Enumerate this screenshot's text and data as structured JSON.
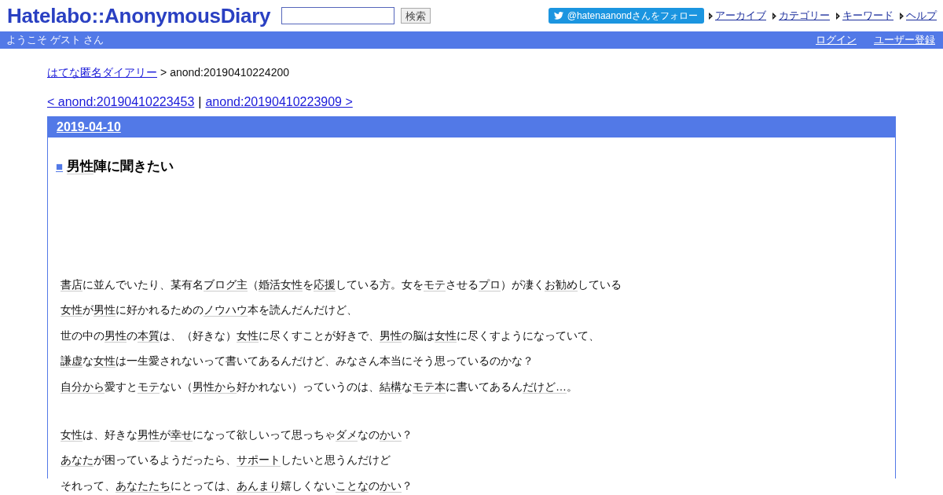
{
  "header": {
    "logo": "Hatelabo::AnonymousDiary",
    "search": {
      "button": "検索"
    },
    "follow_button": "@hatenaanondさんをフォロー",
    "nav_links": [
      "アーカイブ",
      "カテゴリー",
      "キーワード",
      "ヘルプ"
    ],
    "welcome": "ようこそ ゲスト さん",
    "user_links": [
      "ログイン",
      "ユーザー登録"
    ]
  },
  "breadcrumb": {
    "link": "はてな匿名ダイアリー",
    "separator": ">",
    "current": "anond:20190410224200"
  },
  "pager": {
    "prev": "< anond:20190410223453",
    "separator": "|",
    "next": "anond:20190410223909 >"
  },
  "entry": {
    "date": "2019-04-10",
    "title_mark": "■",
    "title": [
      {
        "text": "男性",
        "kind": "keyword"
      },
      {
        "text": "陣に聞きたい",
        "kind": "plain"
      }
    ],
    "paragraphs": [
      [
        [
          {
            "text": "書店",
            "kind": "keyword"
          },
          {
            "text": "に並んでいたり、某有名",
            "kind": "plain"
          },
          {
            "text": "ブログ主",
            "kind": "keyword"
          },
          {
            "text": "（",
            "kind": "plain"
          },
          {
            "text": "婚活",
            "kind": "keyword"
          },
          {
            "text": "女性",
            "kind": "keyword"
          },
          {
            "text": "を",
            "kind": "plain"
          },
          {
            "text": "応援",
            "kind": "keyword"
          },
          {
            "text": "している方。女を",
            "kind": "plain"
          },
          {
            "text": "モテ",
            "kind": "keyword"
          },
          {
            "text": "させる",
            "kind": "plain"
          },
          {
            "text": "プロ",
            "kind": "keyword"
          },
          {
            "text": "）が凄く",
            "kind": "plain"
          },
          {
            "text": "お勧め",
            "kind": "keyword"
          },
          {
            "text": "している",
            "kind": "plain"
          }
        ],
        [
          {
            "text": "女性",
            "kind": "keyword"
          },
          {
            "text": "が",
            "kind": "plain"
          },
          {
            "text": "男性",
            "kind": "keyword"
          },
          {
            "text": "に好かれるための",
            "kind": "plain"
          },
          {
            "text": "ノウハウ",
            "kind": "keyword"
          },
          {
            "text": "本を読んだんだけど、",
            "kind": "plain"
          }
        ],
        [
          {
            "text": "世の中の",
            "kind": "plain"
          },
          {
            "text": "男性",
            "kind": "keyword"
          },
          {
            "text": "の",
            "kind": "plain"
          },
          {
            "text": "本質",
            "kind": "keyword"
          },
          {
            "text": "は、（好きな）",
            "kind": "plain"
          },
          {
            "text": "女性",
            "kind": "keyword"
          },
          {
            "text": "に尽くすことが好きで、",
            "kind": "plain"
          },
          {
            "text": "男性",
            "kind": "keyword"
          },
          {
            "text": "の脳は",
            "kind": "plain"
          },
          {
            "text": "女性",
            "kind": "keyword"
          },
          {
            "text": "に尽くすようになっていて、",
            "kind": "plain"
          }
        ],
        [
          {
            "text": "謙虚",
            "kind": "keyword"
          },
          {
            "text": "な",
            "kind": "plain"
          },
          {
            "text": "女性",
            "kind": "keyword"
          },
          {
            "text": "は一生愛されないって書いてあるんだけど、みなさん本当にそう思っているのかな？",
            "kind": "plain"
          }
        ],
        [
          {
            "text": "自分から",
            "kind": "keyword"
          },
          {
            "text": "愛すと",
            "kind": "plain"
          },
          {
            "text": "モテ",
            "kind": "keyword"
          },
          {
            "text": "ない（",
            "kind": "plain"
          },
          {
            "text": "男性から",
            "kind": "keyword"
          },
          {
            "text": "好かれない）っていうのは、",
            "kind": "plain"
          },
          {
            "text": "結構",
            "kind": "keyword"
          },
          {
            "text": "な",
            "kind": "plain"
          },
          {
            "text": "モテ本",
            "kind": "keyword"
          },
          {
            "text": "に書いてあるん",
            "kind": "plain"
          },
          {
            "text": "だけど…",
            "kind": "keyword"
          },
          {
            "text": "。",
            "kind": "plain"
          }
        ]
      ],
      [
        [
          {
            "text": "女性",
            "kind": "keyword"
          },
          {
            "text": "は、好きな",
            "kind": "plain"
          },
          {
            "text": "男性",
            "kind": "keyword"
          },
          {
            "text": "が",
            "kind": "plain"
          },
          {
            "text": "幸せ",
            "kind": "keyword"
          },
          {
            "text": "になって欲しいって思っちゃ",
            "kind": "plain"
          },
          {
            "text": "ダメ",
            "kind": "keyword"
          },
          {
            "text": "なの",
            "kind": "plain"
          },
          {
            "text": "かい",
            "kind": "keyword"
          },
          {
            "text": "？",
            "kind": "plain"
          }
        ],
        [
          {
            "text": "あなた",
            "kind": "keyword"
          },
          {
            "text": "が困っているようだったら、",
            "kind": "plain"
          },
          {
            "text": "サポート",
            "kind": "keyword"
          },
          {
            "text": "したいと思うんだけど",
            "kind": "plain"
          }
        ],
        [
          {
            "text": "それって、",
            "kind": "plain"
          },
          {
            "text": "あなたたち",
            "kind": "keyword"
          },
          {
            "text": "にとっては、",
            "kind": "plain"
          },
          {
            "text": "あんまり",
            "kind": "keyword"
          },
          {
            "text": "嬉しくない",
            "kind": "plain"
          },
          {
            "text": "ことな",
            "kind": "keyword"
          },
          {
            "text": "の",
            "kind": "plain"
          },
          {
            "text": "かい",
            "kind": "keyword"
          },
          {
            "text": "？",
            "kind": "plain"
          }
        ]
      ]
    ]
  }
}
